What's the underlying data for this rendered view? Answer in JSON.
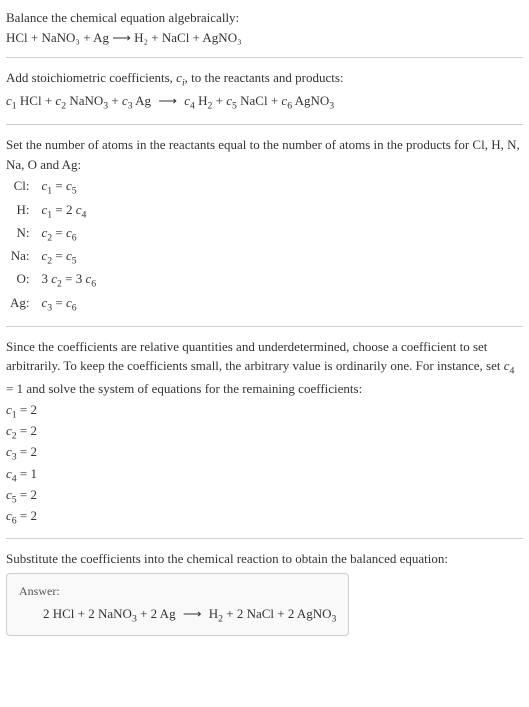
{
  "prompt": {
    "line1": "Balance the chemical equation algebraically:",
    "equation": "HCl + NaNO₃ + Ag ⟶ H₂ + NaCl + AgNO₃"
  },
  "step_coeff": {
    "intro": "Add stoichiometric coefficients, cᵢ, to the reactants and products:",
    "equation": "c₁ HCl + c₂ NaNO₃ + c₃ Ag ⟶ c₄ H₂ + c₅ NaCl + c₆ AgNO₃"
  },
  "step_atoms": {
    "intro": "Set the number of atoms in the reactants equal to the number of atoms in the products for Cl, H, N, Na, O and Ag:",
    "rows": [
      {
        "label": "Cl:",
        "eq": "c₁ = c₅"
      },
      {
        "label": "H:",
        "eq": "c₁ = 2 c₄"
      },
      {
        "label": "N:",
        "eq": "c₂ = c₆"
      },
      {
        "label": "Na:",
        "eq": "c₂ = c₅"
      },
      {
        "label": "O:",
        "eq": "3 c₂ = 3 c₆"
      },
      {
        "label": "Ag:",
        "eq": "c₃ = c₆"
      }
    ]
  },
  "step_solve": {
    "intro": "Since the coefficients are relative quantities and underdetermined, choose a coefficient to set arbitrarily. To keep the coefficients small, the arbitrary value is ordinarily one. For instance, set c₄ = 1 and solve the system of equations for the remaining coefficients:",
    "coeffs": [
      "c₁ = 2",
      "c₂ = 2",
      "c₃ = 2",
      "c₄ = 1",
      "c₅ = 2",
      "c₆ = 2"
    ]
  },
  "step_final": {
    "intro": "Substitute the coefficients into the chemical reaction to obtain the balanced equation:",
    "answer_label": "Answer:",
    "equation": "2 HCl + 2 NaNO₃ + 2 Ag ⟶ H₂ + 2 NaCl + 2 AgNO₃"
  }
}
